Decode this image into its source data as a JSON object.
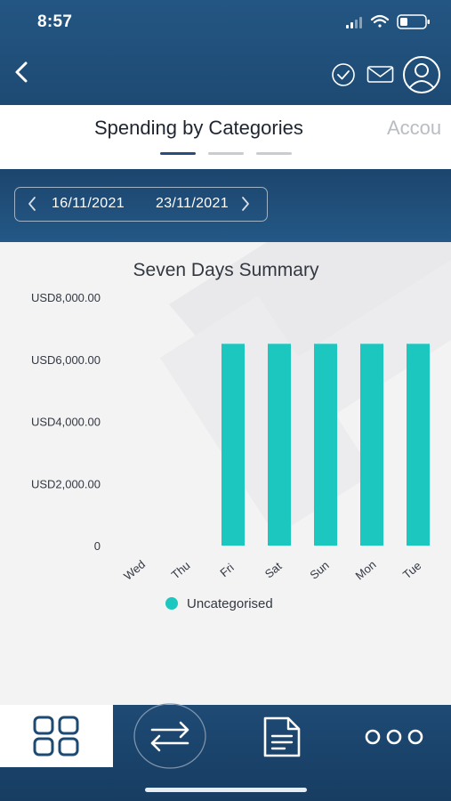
{
  "status_bar": {
    "time": "8:57"
  },
  "tabs": [
    {
      "label": "Spending by Categories"
    },
    {
      "label": "Accou"
    }
  ],
  "date_range": {
    "start": "16/11/2021",
    "end": "23/11/2021"
  },
  "chart_data": {
    "type": "bar",
    "title": "Seven Days Summary",
    "categories": [
      "Wed",
      "Thu",
      "Fri",
      "Sat",
      "Sun",
      "Mon",
      "Tue"
    ],
    "series": [
      {
        "name": "Uncategorised",
        "values": [
          0,
          0,
          6500,
          6500,
          6500,
          6500,
          6500
        ]
      }
    ],
    "ylim": [
      0,
      8000
    ],
    "y_ticks": [
      {
        "value": 0,
        "label": "0"
      },
      {
        "value": 2000,
        "label": "USD2,000.00"
      },
      {
        "value": 4000,
        "label": "USD4,000.00"
      },
      {
        "value": 6000,
        "label": "USD6,000.00"
      },
      {
        "value": 8000,
        "label": "USD8,000.00"
      }
    ],
    "color": "#1cc7bf",
    "grid": false,
    "legend_position": "bottom"
  },
  "colors": {
    "header": "#1d4a73",
    "accent": "#1cc7bf",
    "nav_active": "#ffffff"
  },
  "nav": {
    "items": [
      {
        "icon": "dashboard-grid-icon",
        "active": true
      },
      {
        "icon": "transfer-arrows-icon",
        "active": false
      },
      {
        "icon": "document-icon",
        "active": false
      },
      {
        "icon": "more-dots-icon",
        "active": false
      }
    ]
  }
}
